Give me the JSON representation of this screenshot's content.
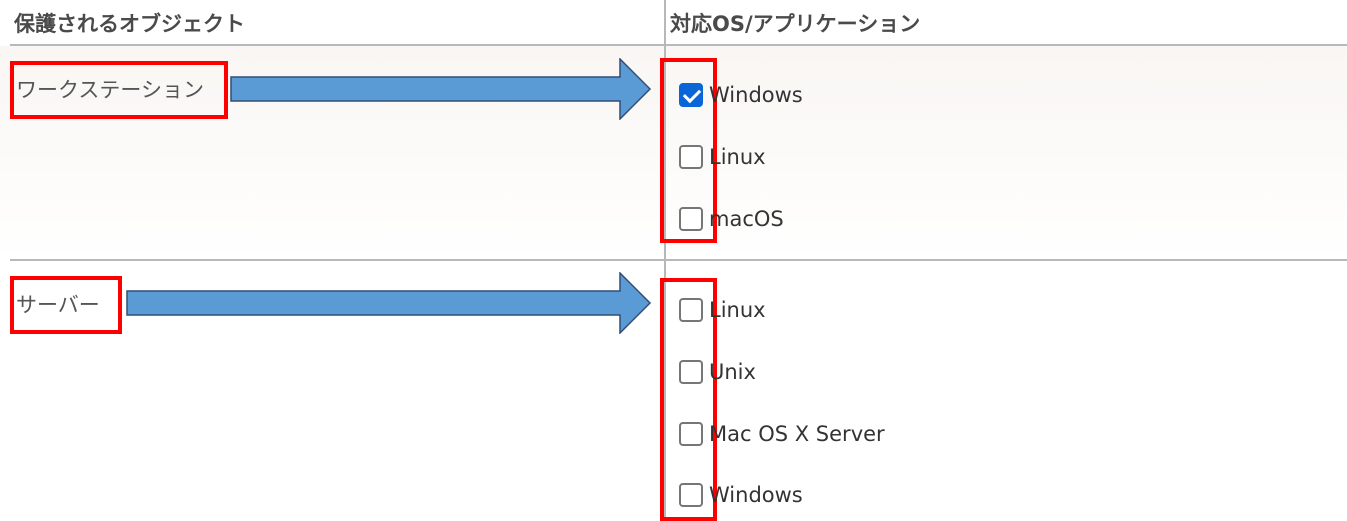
{
  "headers": {
    "object_col": "保護されるオブジェクト",
    "os_col": "対応OS/アプリケーション"
  },
  "groups": [
    {
      "label": "ワークステーション",
      "options": [
        {
          "label": "Windows",
          "checked": true
        },
        {
          "label": "Linux",
          "checked": false
        },
        {
          "label": "macOS",
          "checked": false
        }
      ]
    },
    {
      "label": "サーバー",
      "options": [
        {
          "label": "Linux",
          "checked": false
        },
        {
          "label": "Unix",
          "checked": false
        },
        {
          "label": "Mac OS X Server",
          "checked": false
        },
        {
          "label": "Windows",
          "checked": false
        }
      ]
    }
  ],
  "colors": {
    "highlight": "#ff0000",
    "arrow_fill": "#5b9bd5",
    "arrow_stroke": "#2f4f76",
    "checkbox_checked": "#0a66d6"
  }
}
